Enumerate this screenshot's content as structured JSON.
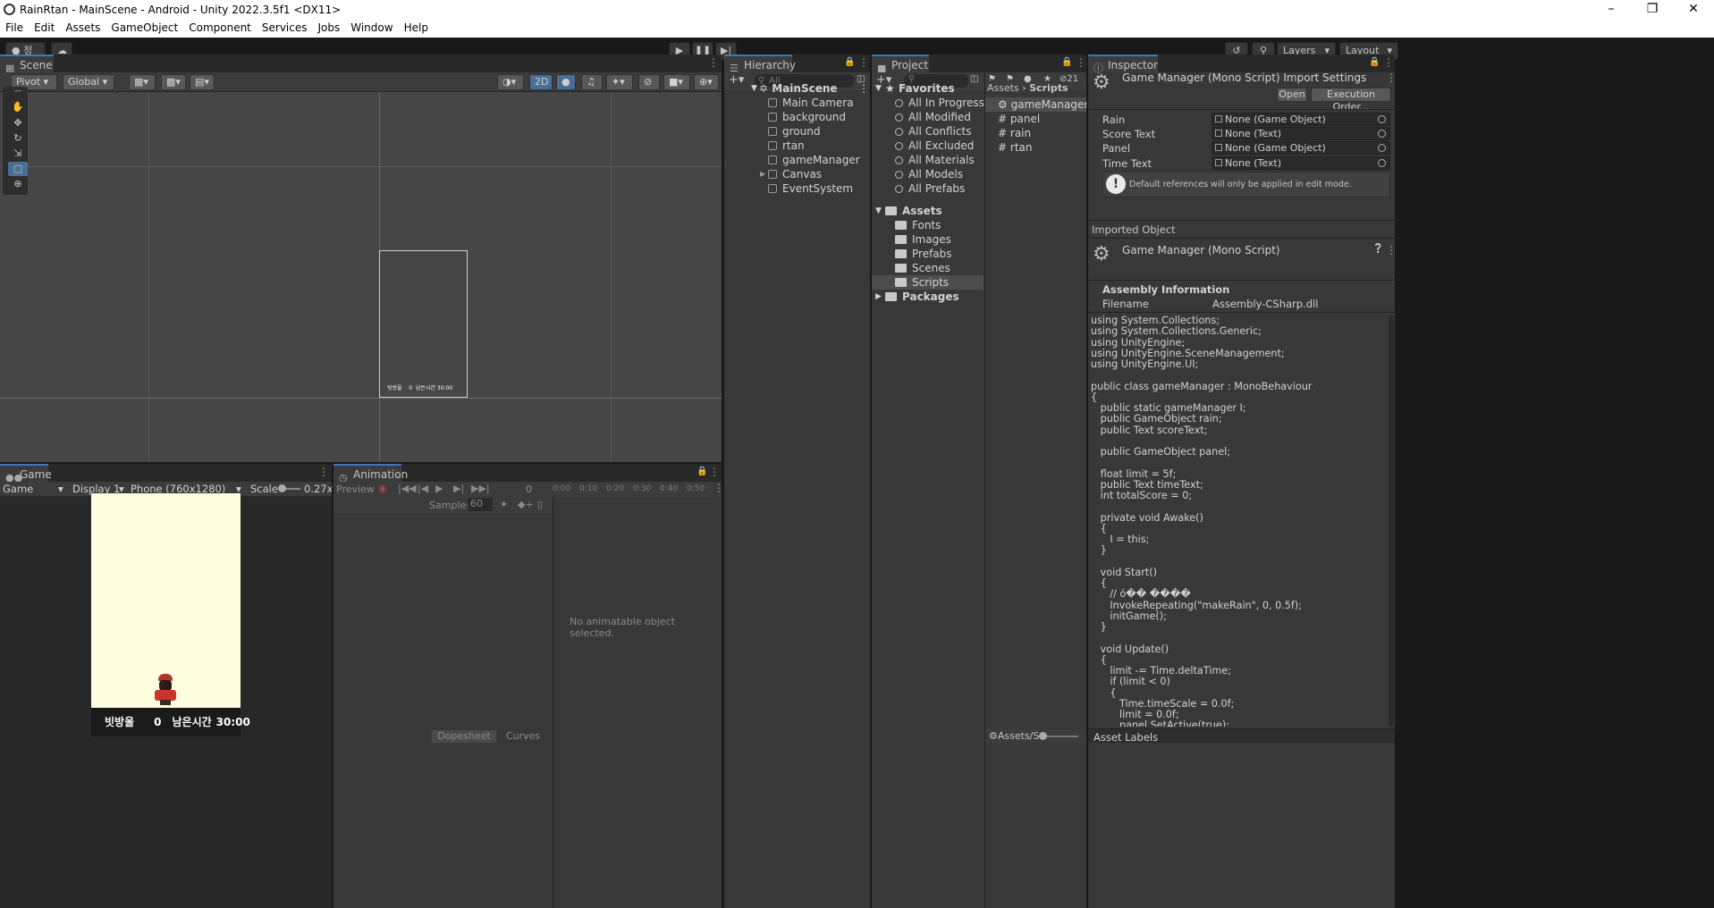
{
  "window": {
    "title": "RainRtan - MainScene - Android - Unity 2022.3.5f1 <DX11>"
  },
  "menu": [
    "File",
    "Edit",
    "Assets",
    "GameObject",
    "Component",
    "Services",
    "Jobs",
    "Window",
    "Help"
  ],
  "toolbar": {
    "account": "정",
    "layers": "Layers",
    "layout": "Layout"
  },
  "scene": {
    "tab": "Scene",
    "pivot": "Pivot",
    "global": "Global",
    "mode2d": "2D",
    "canvas_score_label": "빗방울",
    "canvas_score": "0",
    "canvas_time_label": "남은시간",
    "canvas_time": "30:00"
  },
  "game": {
    "tab": "Game",
    "mode": "Game",
    "display": "Display 1",
    "resolution": "Phone (760x1280)",
    "scale_label": "Scale",
    "scale_value": "0.27x",
    "score_label": "빗방울",
    "score": "0",
    "time_label": "남은시간",
    "time": "30:00"
  },
  "animation": {
    "tab": "Animation",
    "preview": "Preview",
    "frame": "0",
    "samples_label": "Samples",
    "samples": "60",
    "ticks": [
      "0:00",
      "0:10",
      "0:20",
      "0:30",
      "0:40",
      "0:50"
    ],
    "empty_message": "No animatable object selected.",
    "dopesheet": "Dopesheet",
    "curves": "Curves"
  },
  "hierarchy": {
    "tab": "Hierarchy",
    "search_placeholder": "All",
    "scene_name": "MainScene",
    "items": [
      "Main Camera",
      "background",
      "ground",
      "rtan",
      "gameManager",
      "Canvas",
      "EventSystem"
    ]
  },
  "project": {
    "tab": "Project",
    "hidden_count": "21",
    "favorites_label": "Favorites",
    "favorites": [
      "All In Progress",
      "All Modified",
      "All Conflicts",
      "All Excluded",
      "All Materials",
      "All Models",
      "All Prefabs"
    ],
    "assets_label": "Assets",
    "asset_folders": [
      "Fonts",
      "Images",
      "Prefabs",
      "Scenes",
      "Scripts"
    ],
    "packages_label": "Packages",
    "breadcrumb_root": "Assets",
    "breadcrumb_current": "Scripts",
    "files": [
      "gameManager",
      "panel",
      "rain",
      "rtan"
    ],
    "footer_path": "Assets/S"
  },
  "inspector": {
    "tab": "Inspector",
    "title": "Game Manager (Mono Script) Import Settings",
    "open": "Open",
    "execution_order": "Execution Order...",
    "fields": [
      {
        "label": "Rain",
        "value": "None (Game Object)"
      },
      {
        "label": "Score Text",
        "value": "None (Text)"
      },
      {
        "label": "Panel",
        "value": "None (Game Object)"
      },
      {
        "label": "Time Text",
        "value": "None (Text)"
      }
    ],
    "info": "Default references will only be applied in edit mode.",
    "imported_object": "Imported Object",
    "object_title": "Game Manager (Mono Script)",
    "assembly_info": "Assembly Information",
    "filename_label": "Filename",
    "filename": "Assembly-CSharp.dll",
    "code": "using System.Collections;\nusing System.Collections.Generic;\nusing UnityEngine;\nusing UnityEngine.SceneManagement;\nusing UnityEngine.UI;\n\npublic class gameManager : MonoBehaviour\n{\n   public static gameManager I;\n   public GameObject rain;\n   public Text scoreText;\n\n   public GameObject panel;\n\n   float limit = 5f;\n   public Text timeText;\n   int totalScore = 0;\n\n   private void Awake()\n   {\n      I = this;\n   }\n\n   void Start()\n   {\n      // ó�� ����\n      InvokeRepeating(\"makeRain\", 0, 0.5f);\n      initGame();\n   }\n\n   void Update()\n   {\n      limit -= Time.deltaTime;\n      if (limit < 0)\n      {\n         Time.timeScale = 0.0f;\n         limit = 0.0f;\n         panel.SetActive(true);",
    "asset_labels": "Asset Labels"
  }
}
